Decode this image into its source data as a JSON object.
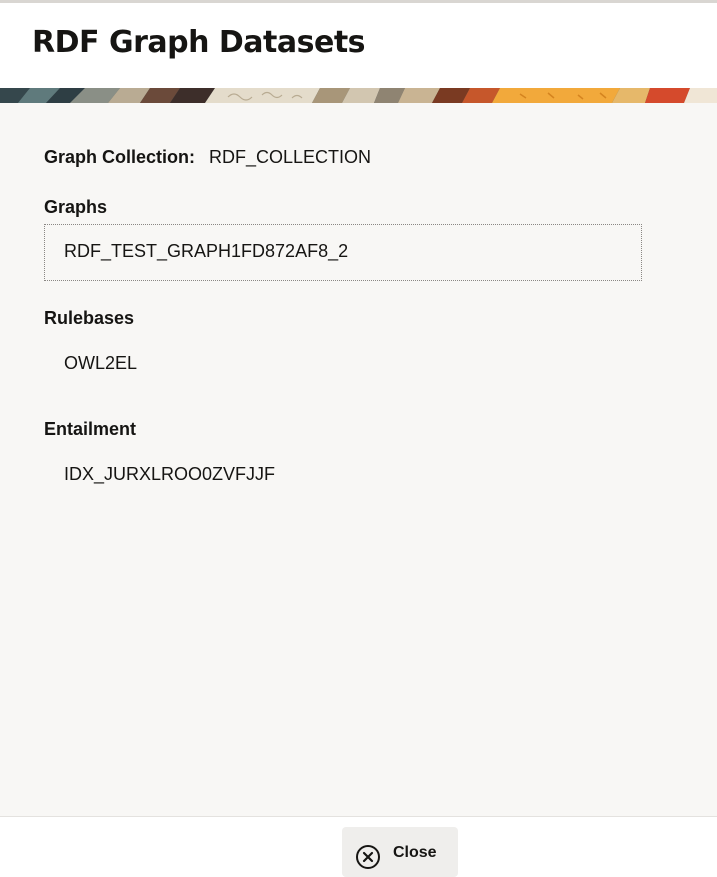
{
  "dialog": {
    "title": "RDF Graph Datasets"
  },
  "collection": {
    "label": "Graph Collection:",
    "value": "RDF_COLLECTION"
  },
  "graphs": {
    "label": "Graphs",
    "items": [
      "RDF_TEST_GRAPH1FD872AF8_2"
    ]
  },
  "rulebases": {
    "label": "Rulebases",
    "items": [
      "OWL2EL"
    ]
  },
  "entailment": {
    "label": "Entailment",
    "items": [
      "IDX_JURXLROO0ZVFJJF"
    ]
  },
  "footer": {
    "close_label": "Close",
    "close_icon": "close-circle-icon"
  },
  "colors": {
    "content_bg": "#f8f7f5",
    "text": "#161513",
    "button_bg": "#efeeec"
  }
}
